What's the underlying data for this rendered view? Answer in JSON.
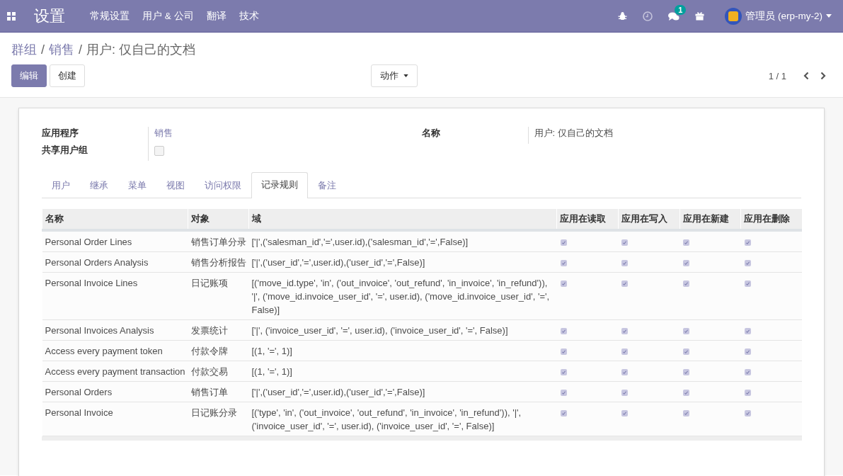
{
  "navbar": {
    "app_title": "设置",
    "menu": [
      "常规设置",
      "用户 & 公司",
      "翻译",
      "技术"
    ],
    "messages_badge": "1",
    "user": "管理员 (erp-my-2)"
  },
  "breadcrumb": [
    "群组",
    "销售",
    "用户: 仅自己的文档"
  ],
  "breadcrumb_separator": "/",
  "buttons": {
    "edit": "编辑",
    "create": "创建",
    "action": "动作"
  },
  "pager": "1 / 1",
  "form": {
    "application_label": "应用程序",
    "application": "销售",
    "shared_label": "共享用户组",
    "shared": false,
    "name_label": "名称",
    "name": "用户: 仅自己的文档"
  },
  "tabs": [
    {
      "label": "用户",
      "selected": false
    },
    {
      "label": "继承",
      "selected": false
    },
    {
      "label": "菜单",
      "selected": false
    },
    {
      "label": "视图",
      "selected": false
    },
    {
      "label": "访问权限",
      "selected": false
    },
    {
      "label": "记录规则",
      "selected": true
    },
    {
      "label": "备注",
      "selected": false
    }
  ],
  "table": {
    "columns": [
      "名称",
      "对象",
      "域",
      "应用在读取",
      "应用在写入",
      "应用在新建",
      "应用在删除"
    ],
    "rows": [
      {
        "name": "Personal Order Lines",
        "object": "销售订单分录",
        "domain": "['|',('salesman_id','=',user.id),('salesman_id','=',False)]",
        "read": true,
        "write": true,
        "create": true,
        "delete": true
      },
      {
        "name": "Personal Orders Analysis",
        "object": "销售分析报告",
        "domain": "['|',('user_id','=',user.id),('user_id','=',False)]",
        "read": true,
        "write": true,
        "create": true,
        "delete": true
      },
      {
        "name": "Personal Invoice Lines",
        "object": "日记账项",
        "domain": "[('move_id.type', 'in', ('out_invoice', 'out_refund', 'in_invoice', 'in_refund')), '|', ('move_id.invoice_user_id', '=', user.id), ('move_id.invoice_user_id', '=', False)]",
        "read": true,
        "write": true,
        "create": true,
        "delete": true
      },
      {
        "name": "Personal Invoices Analysis",
        "object": "发票统计",
        "domain": "['|', ('invoice_user_id', '=', user.id), ('invoice_user_id', '=', False)]",
        "read": true,
        "write": true,
        "create": true,
        "delete": true
      },
      {
        "name": "Access every payment token",
        "object": "付款令牌",
        "domain": "[(1, '=', 1)]",
        "read": true,
        "write": true,
        "create": true,
        "delete": true
      },
      {
        "name": "Access every payment transaction",
        "object": "付款交易",
        "domain": "[(1, '=', 1)]",
        "read": true,
        "write": true,
        "create": true,
        "delete": true
      },
      {
        "name": "Personal Orders",
        "object": "销售订单",
        "domain": "['|',('user_id','=',user.id),('user_id','=',False)]",
        "read": true,
        "write": true,
        "create": true,
        "delete": true
      },
      {
        "name": "Personal Invoice",
        "object": "日记账分录",
        "domain": "[('type', 'in', ('out_invoice', 'out_refund', 'in_invoice', 'in_refund')), '|', ('invoice_user_id', '=', user.id), ('invoice_user_id', '=', False)]",
        "read": true,
        "write": true,
        "create": true,
        "delete": true
      }
    ]
  }
}
